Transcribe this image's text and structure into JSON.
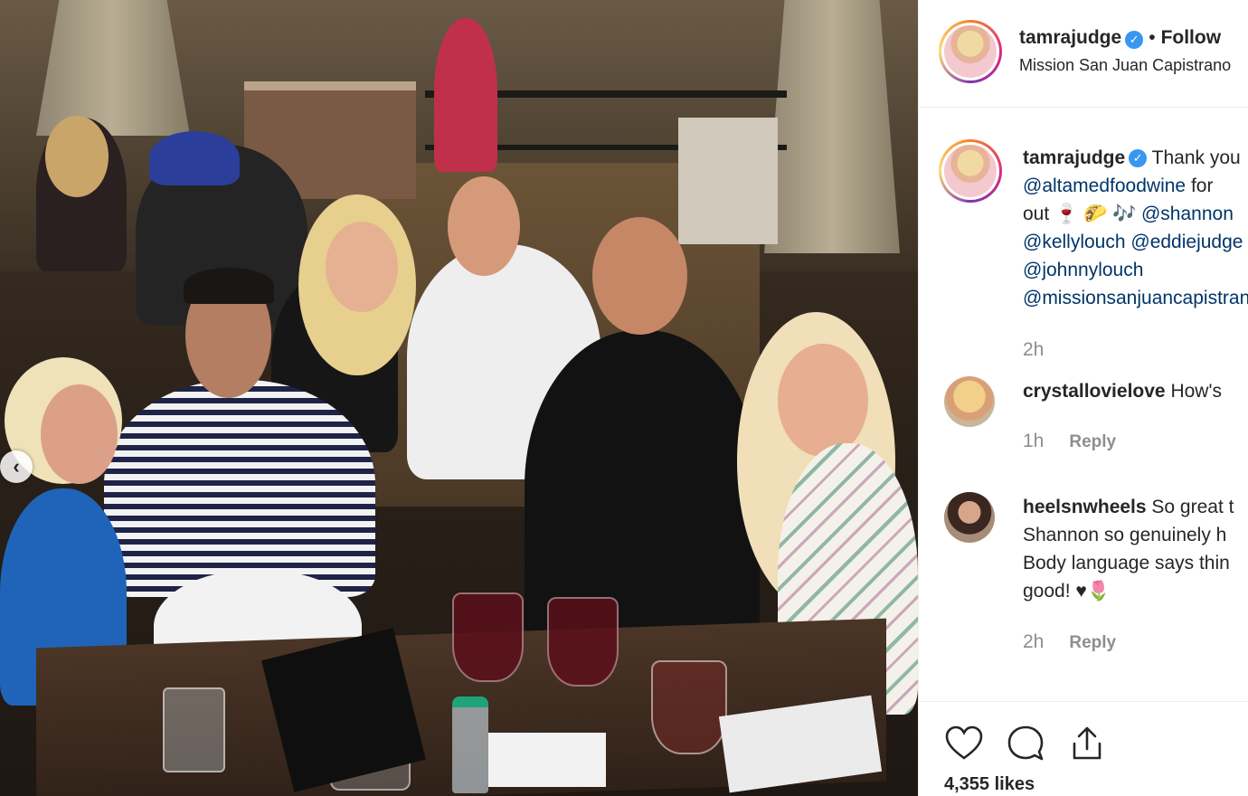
{
  "post": {
    "username": "tamrajudge",
    "follow_label": "Follow",
    "separator": "•",
    "location": "Mission San Juan Capistrano",
    "likes": "4,355 likes"
  },
  "caption": {
    "username": "tamrajudge",
    "line1": "Thank you",
    "line2_mention": "@altamedfoodwine",
    "line2_text": "for",
    "line3_text": "out 🍷 🌮 🎶",
    "line3_mention": "@shannon",
    "line4_mention_a": "@kellylouch",
    "line4_mention_b": "@eddiejudge",
    "line5_mention": "@johnnylouch",
    "line6_mention": "@missionsanjuancapistrano",
    "time": "2h"
  },
  "comments": [
    {
      "username": "crystallovielove",
      "lines": [
        "How's"
      ],
      "time": "1h",
      "reply_label": "Reply"
    },
    {
      "username": "heelsnwheels",
      "lines": [
        "So great t",
        "Shannon so genuinely h",
        "Body language says thin",
        "good! ♥🌷"
      ],
      "time": "2h",
      "reply_label": "Reply"
    }
  ],
  "icons": {
    "like": "heart-icon",
    "comment": "comment-icon",
    "share": "share-icon",
    "verified": "verified-badge-icon",
    "carousel_prev": "chevron-left-icon"
  },
  "colors": {
    "link": "#003569",
    "verified": "#3897f0",
    "muted": "#8e8e8e",
    "text": "#262626"
  }
}
